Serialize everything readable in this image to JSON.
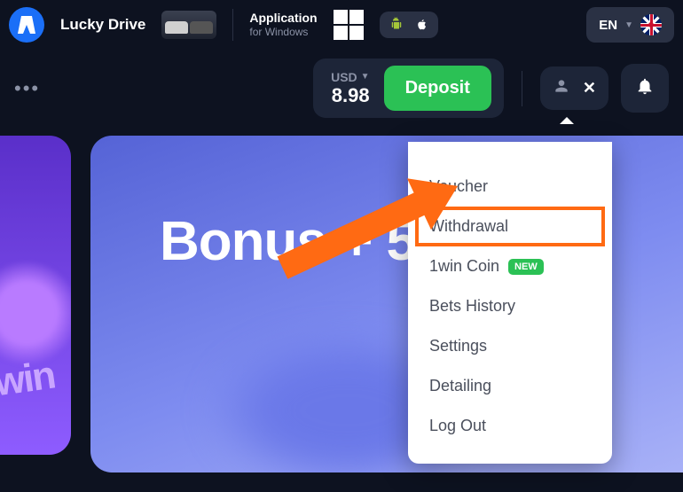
{
  "topbar": {
    "lucky_drive": "Lucky Drive",
    "app_label": "Application",
    "app_sub": "for Windows",
    "lang": "EN"
  },
  "balance": {
    "currency": "USD",
    "value": "8.98",
    "deposit_label": "Deposit"
  },
  "banner": {
    "headline": "Bonus + 5"
  },
  "dropdown": {
    "items": [
      {
        "label": "Voucher"
      },
      {
        "label": "Withdrawal",
        "highlighted": true
      },
      {
        "label": "1win Coin",
        "badge": "NEW"
      },
      {
        "label": "Bets History"
      },
      {
        "label": "Settings"
      },
      {
        "label": "Detailing"
      },
      {
        "label": "Log Out"
      }
    ]
  }
}
